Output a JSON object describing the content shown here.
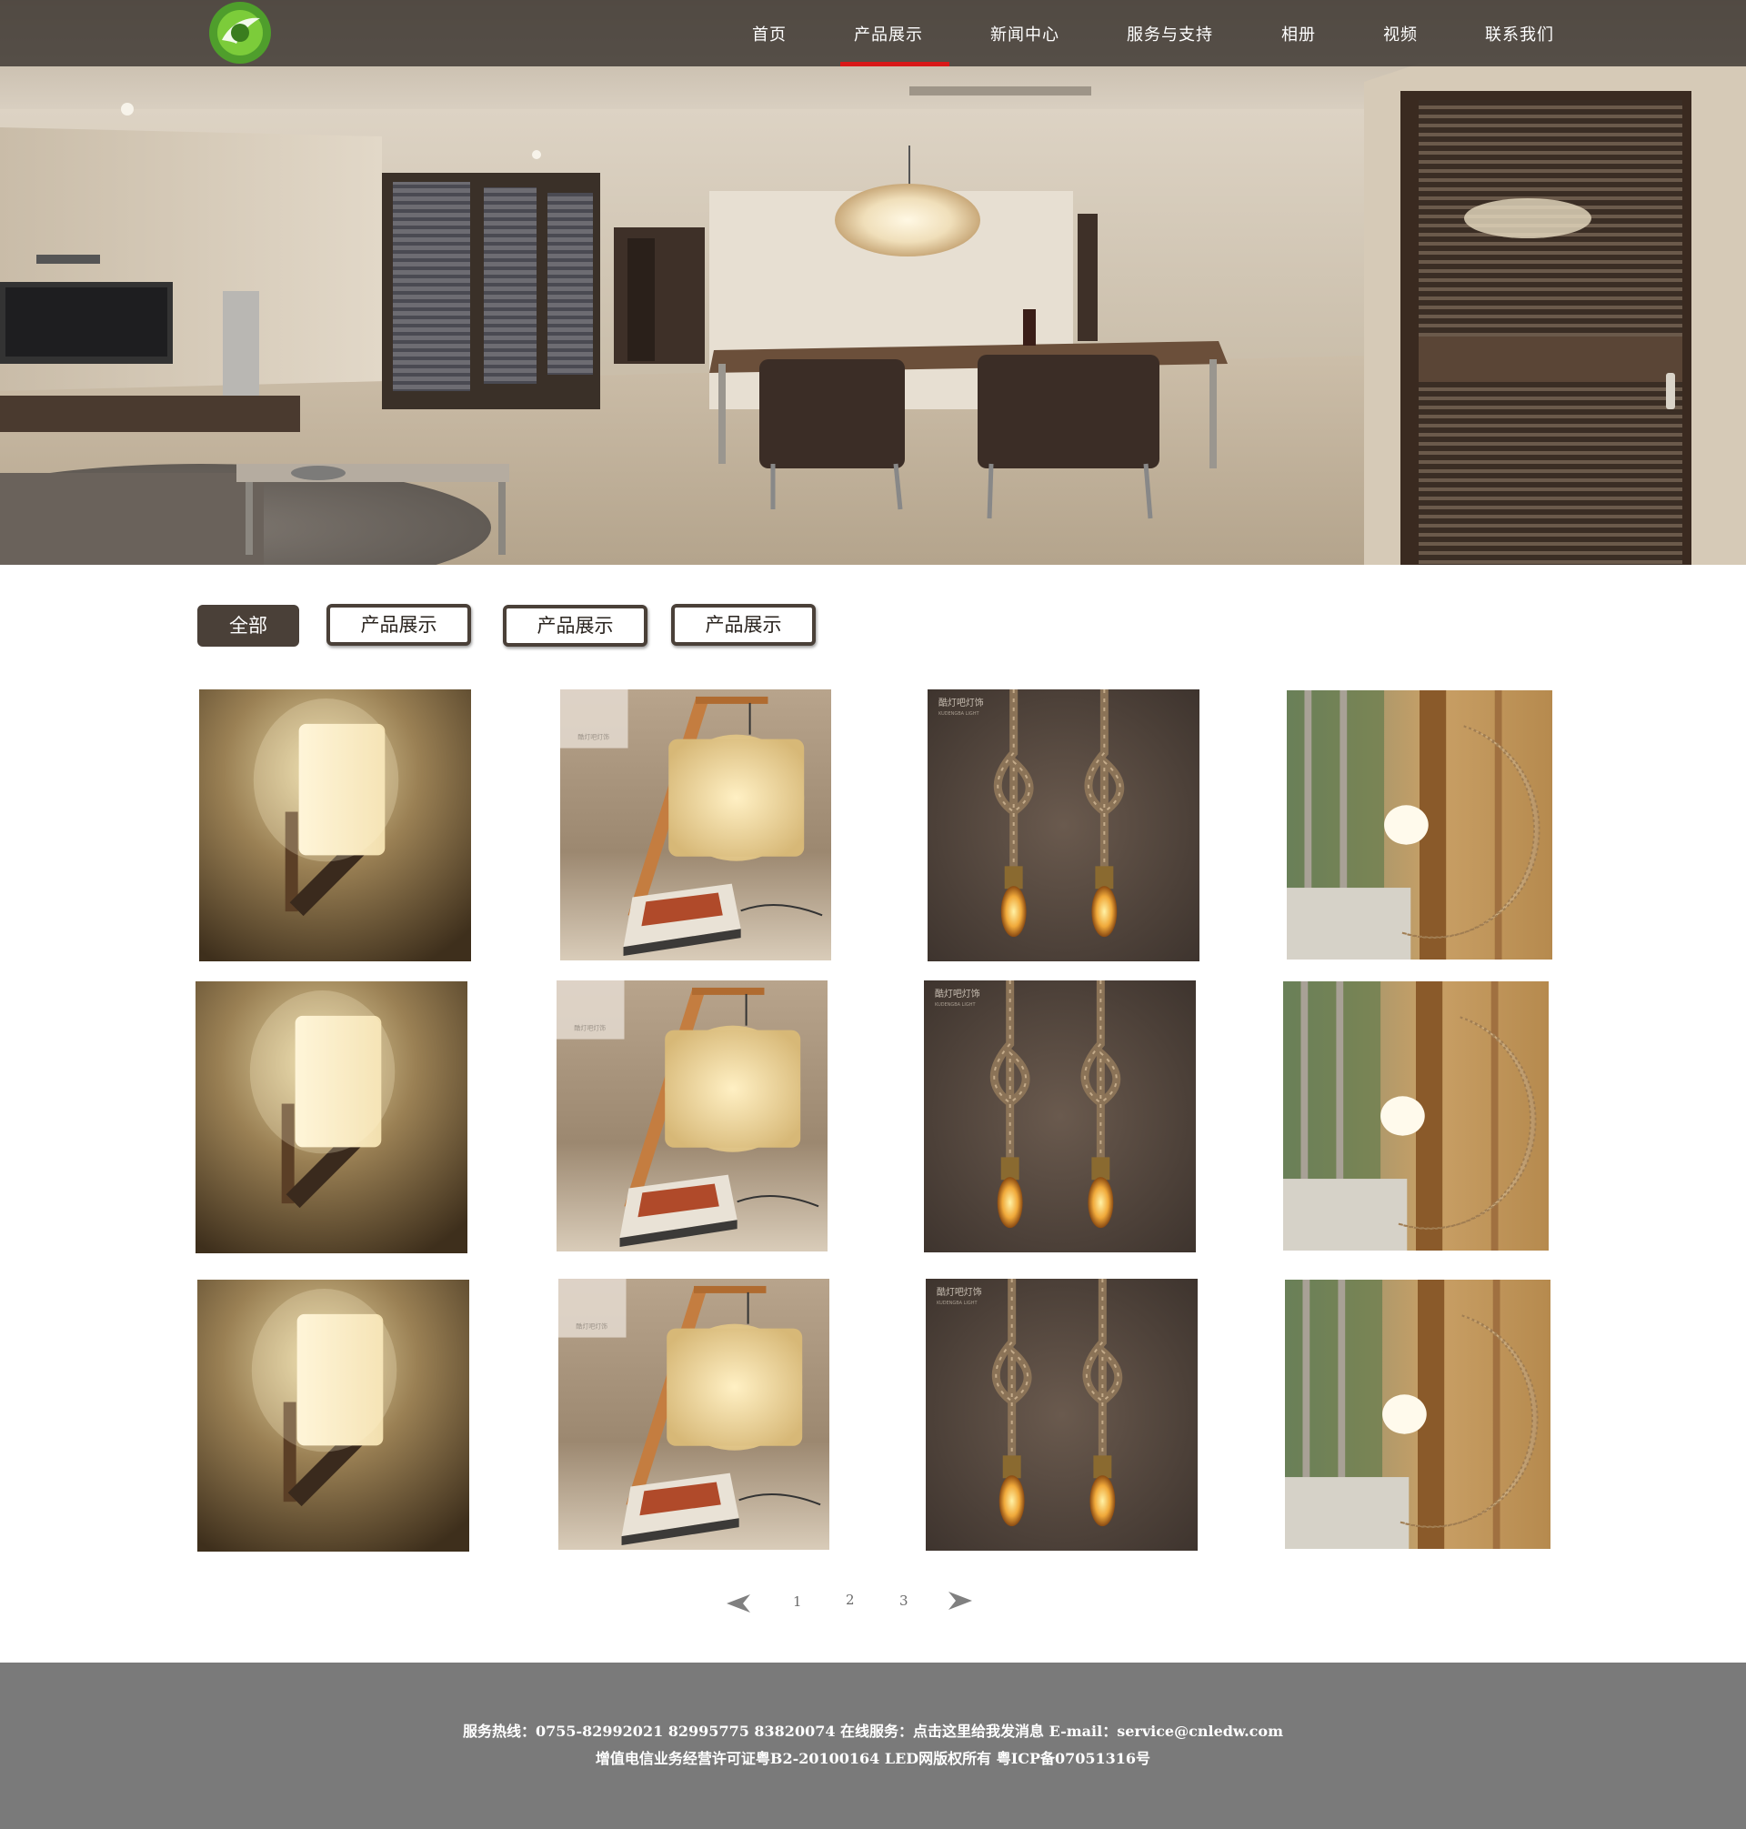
{
  "nav": {
    "items": [
      "首页",
      "产品展示",
      "新闻中心",
      "服务与支持",
      "相册",
      "视频",
      "联系我们"
    ],
    "active_index": 1,
    "active_color": "#d81818"
  },
  "logo": {
    "icon": "leaf-circle-logo",
    "color": "#5aa832"
  },
  "filters": {
    "all_label": "全部",
    "tabs": [
      "产品展示",
      "产品展示",
      "产品展示"
    ],
    "active_index": 0
  },
  "products": {
    "columns": [
      "wall-sconce-lamp",
      "floor-lamp-with-books",
      "rope-pendant-bulbs",
      "rattan-moon-lamp"
    ],
    "rows": 3,
    "watermark": "酷灯吧灯饰"
  },
  "pagination": {
    "prev": "previous-arrow",
    "pages": [
      "1",
      "2",
      "3"
    ],
    "next": "next-arrow"
  },
  "footer": {
    "line1": "服务热线：0755-82992021 82995775 83820074 在线服务：点击这里给我发消息 E-mail：service@cnledw.com",
    "line2": "增值电信业务经营许可证粤B2-20100164 LED网版权所有  粤ICP备07051316号",
    "background": "#7a7a7a"
  }
}
